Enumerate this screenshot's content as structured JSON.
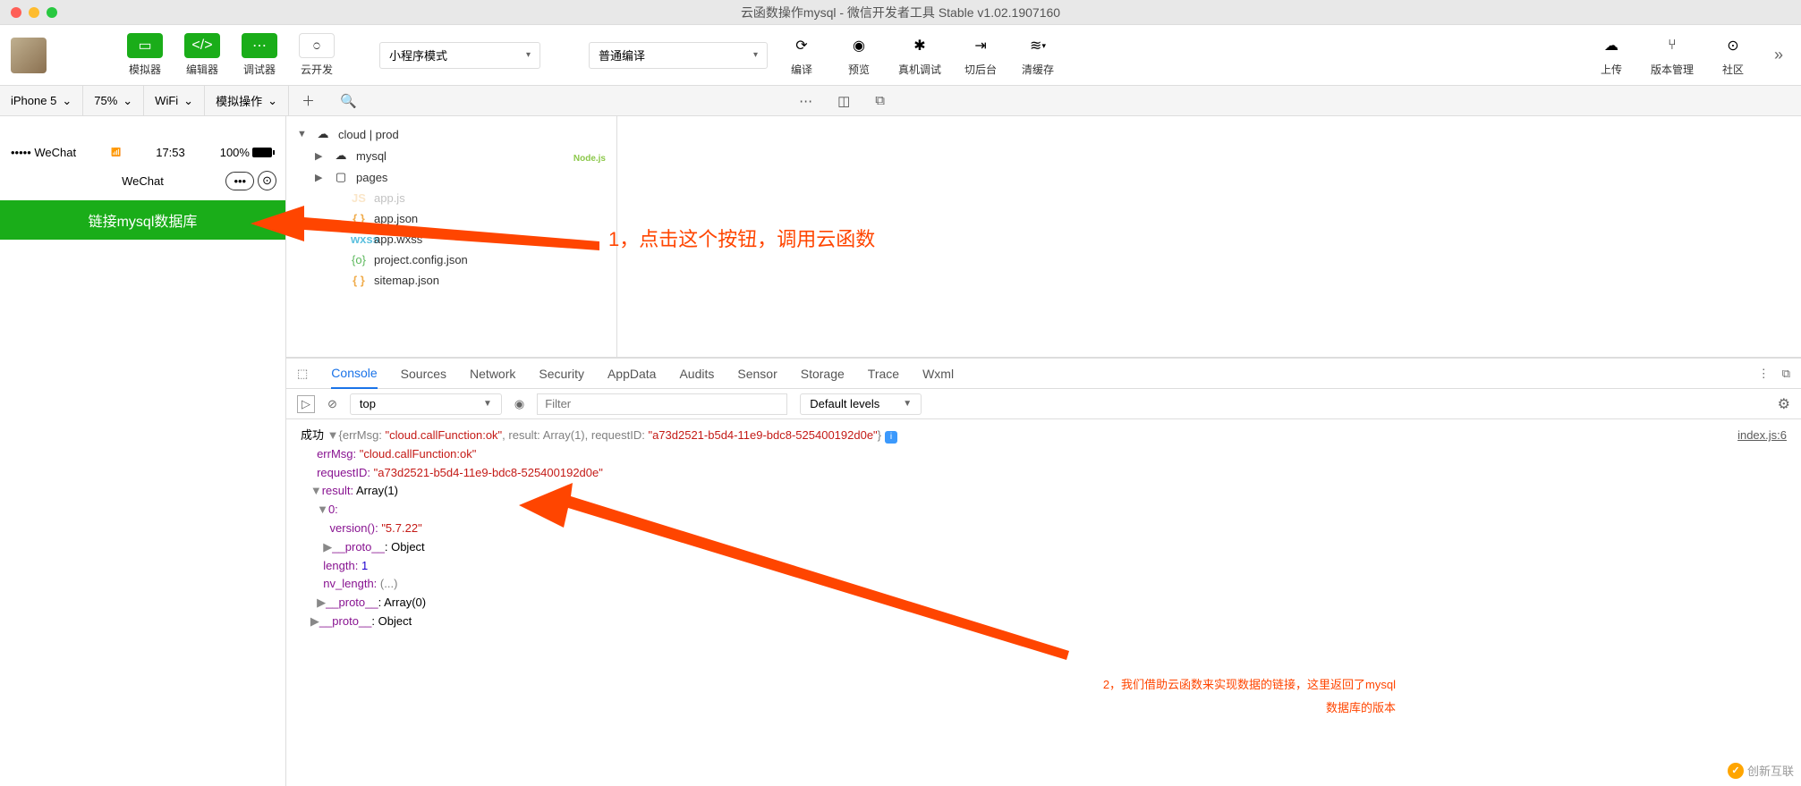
{
  "window": {
    "title": "云函数操作mysql - 微信开发者工具 Stable v1.02.1907160"
  },
  "toolbar": {
    "simulator": "模拟器",
    "editor": "编辑器",
    "debugger": "调试器",
    "cloud": "云开发",
    "mode": "小程序模式",
    "compile_mode": "普通编译",
    "compile": "编译",
    "preview": "预览",
    "remote_debug": "真机调试",
    "background": "切后台",
    "clear_cache": "清缓存",
    "upload": "上传",
    "version": "版本管理",
    "community": "社区"
  },
  "subbar": {
    "device": "iPhone 5",
    "zoom": "75%",
    "network": "WiFi",
    "mock": "模拟操作"
  },
  "sim": {
    "carrier": "••••• WeChat",
    "time": "17:53",
    "battery": "100%",
    "nav_title": "WeChat",
    "button": "链接mysql数据库"
  },
  "tree": {
    "root": "cloud | prod",
    "items": [
      "mysql",
      "pages",
      "app.json",
      "app.wxss",
      "project.config.json",
      "sitemap.json"
    ],
    "badge": "Node.js"
  },
  "devtools": {
    "tabs": [
      "Console",
      "Sources",
      "Network",
      "Security",
      "AppData",
      "Audits",
      "Sensor",
      "Storage",
      "Trace",
      "Wxml"
    ],
    "context": "top",
    "filter_ph": "Filter",
    "levels": "Default levels",
    "source_link": "index.js:6"
  },
  "console": {
    "success": "成功",
    "line1_pre": "{errMsg: ",
    "line1_v1": "\"cloud.callFunction:ok\"",
    "line1_mid": ", result: Array(1), requestID: ",
    "line1_v2": "\"a73d2521-b5d4-11e9-bdc8-525400192d0e\"",
    "line1_end": "}",
    "errMsg_k": "errMsg: ",
    "errMsg_v": "\"cloud.callFunction:ok\"",
    "reqId_k": "requestID: ",
    "reqId_v": "\"a73d2521-b5d4-11e9-bdc8-525400192d0e\"",
    "result_k": "result: ",
    "result_v": "Array(1)",
    "idx": "0:",
    "version_k": "version(): ",
    "version_v": "\"5.7.22\"",
    "proto_k": "__proto__",
    "proto_v": ": Object",
    "length_k": "length: ",
    "length_v": "1",
    "nvlen_k": "nv_length: ",
    "nvlen_v": "(...)",
    "proto_arr_v": ": Array(0)"
  },
  "annotations": {
    "a1": "1，点击这个按钮，调用云函数",
    "a2": "2，我们借助云函数来实现数据的链接，这里返回了mysql",
    "a2b": "数据库的版本"
  },
  "watermark": "创新互联"
}
